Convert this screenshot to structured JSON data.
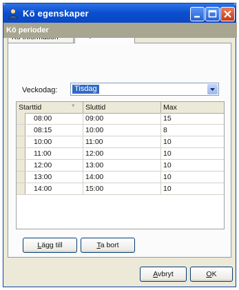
{
  "window": {
    "title": "Kö egenskaper",
    "accent_color": "#0a4fd0",
    "controls": [
      "minimize-icon",
      "maximize-icon",
      "close-icon"
    ]
  },
  "tabs": [
    {
      "label": "Kö information",
      "selected": false
    },
    {
      "label": "Kö perioder",
      "selected": true
    }
  ],
  "section": {
    "header": "Kö perioder"
  },
  "weekday": {
    "label": "Veckodag:",
    "value": "Tisdag"
  },
  "grid": {
    "columns": [
      "Starttid",
      "Sluttid",
      "Max"
    ],
    "rows": [
      [
        "08:00",
        "09:00",
        "15"
      ],
      [
        "08:15",
        "10:00",
        "8"
      ],
      [
        "10:00",
        "11:00",
        "10"
      ],
      [
        "11:00",
        "12:00",
        "10"
      ],
      [
        "12:00",
        "13:00",
        "10"
      ],
      [
        "13:00",
        "14:00",
        "10"
      ],
      [
        "14:00",
        "15:00",
        "10"
      ]
    ]
  },
  "buttons": {
    "add": {
      "mnemonic": "L",
      "rest": "ägg till"
    },
    "remove": {
      "mnemonic": "T",
      "rest": "a bort"
    },
    "cancel": {
      "mnemonic": "A",
      "rest": "vbryt"
    },
    "ok": {
      "mnemonic": "O",
      "rest": "K"
    }
  }
}
